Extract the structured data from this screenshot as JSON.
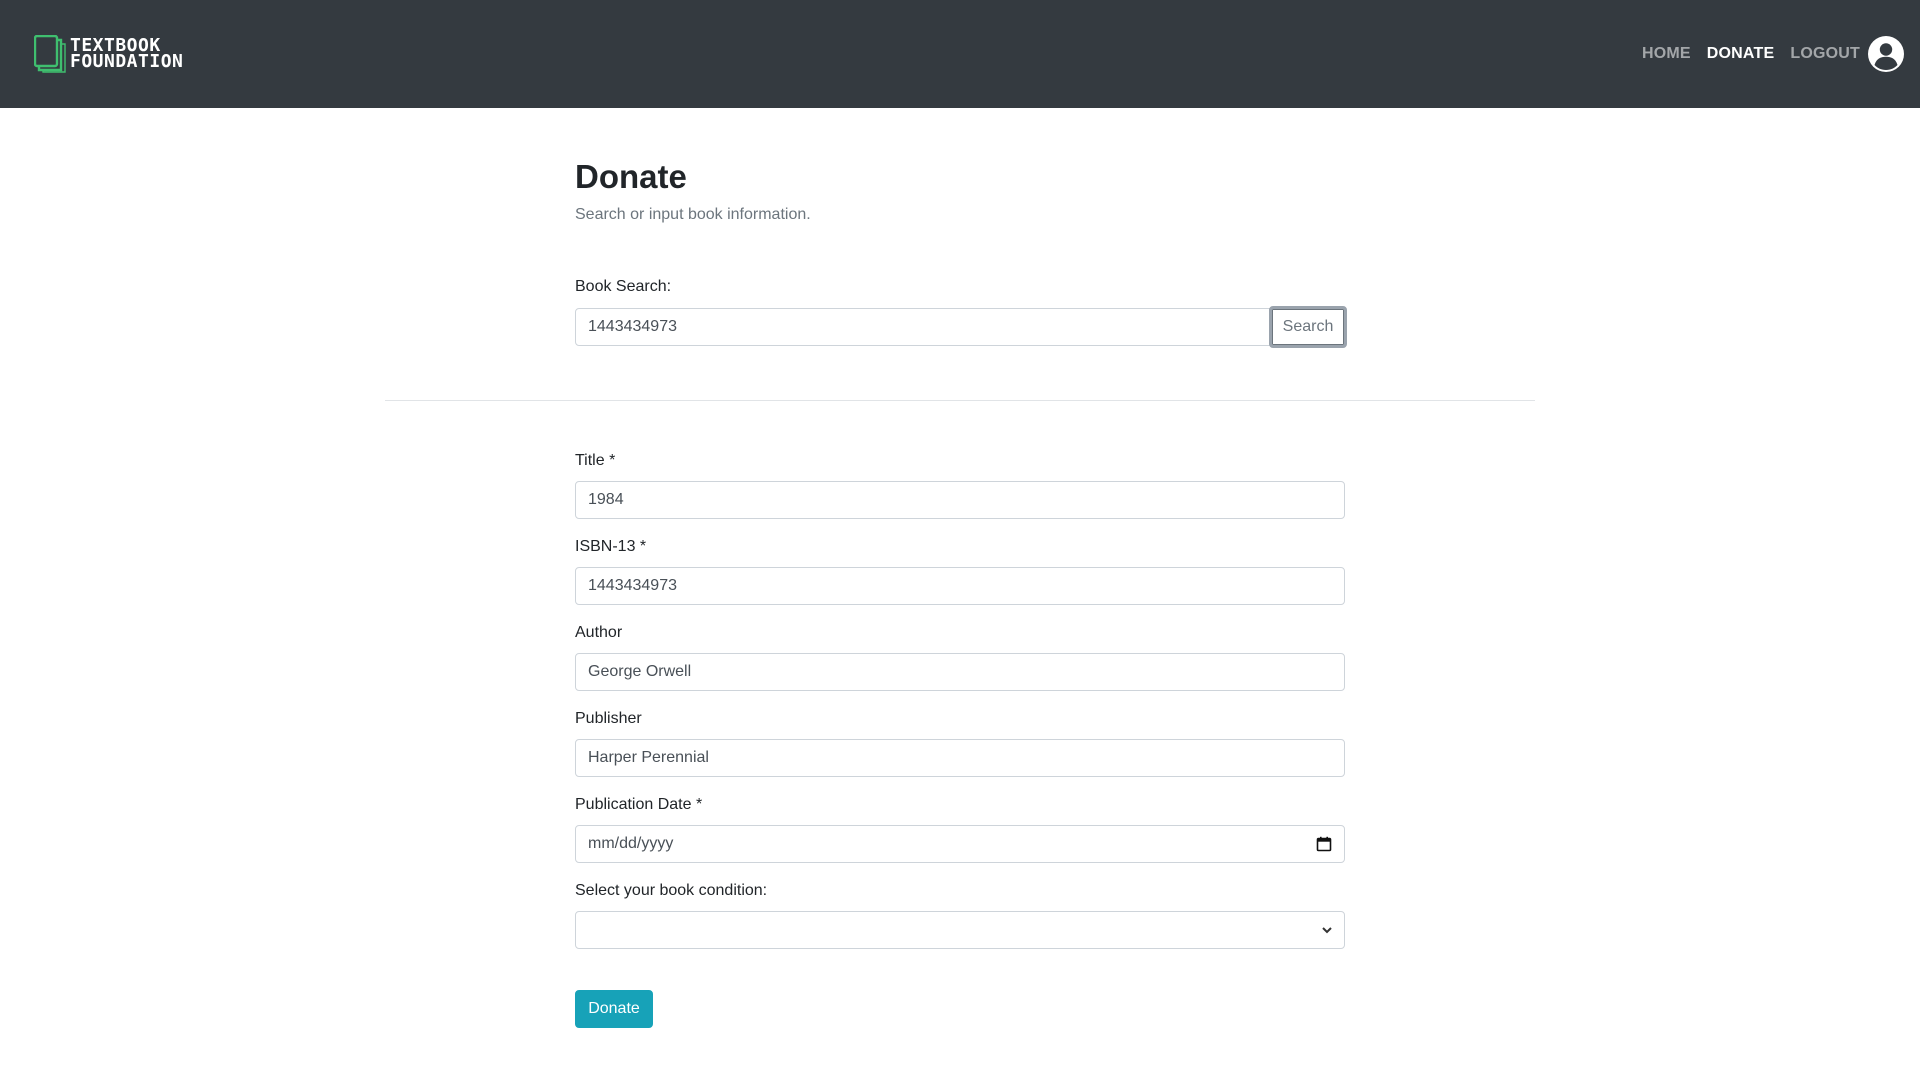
{
  "brand": {
    "line1": "TEXTBOOK",
    "line2": "FOUNDATION",
    "logo_icon": "book-stack-icon",
    "logo_color": "#3fbf6f"
  },
  "nav": {
    "items": [
      {
        "label": "HOME",
        "active": false
      },
      {
        "label": "DONATE",
        "active": true
      },
      {
        "label": "LOGOUT",
        "active": false
      }
    ],
    "user_icon": "user-circle-icon"
  },
  "page": {
    "title": "Donate",
    "subtitle": "Search or input book information."
  },
  "search": {
    "label": "Book Search:",
    "value": "1443434973",
    "button_label": "Search"
  },
  "form": {
    "title": {
      "label": "Title *",
      "value": "1984"
    },
    "isbn": {
      "label": "ISBN-13 *",
      "value": "1443434973"
    },
    "author": {
      "label": "Author",
      "value": "George Orwell"
    },
    "publisher": {
      "label": "Publisher",
      "value": "Harper Perennial"
    },
    "publication_date": {
      "label": "Publication Date *",
      "placeholder": "mm/dd/yyyy"
    },
    "condition": {
      "label": "Select your book condition:",
      "value": ""
    },
    "submit_label": "Donate"
  },
  "colors": {
    "navbar_bg": "#343a40",
    "accent": "#17a2b8",
    "muted_text": "#6c757d"
  }
}
